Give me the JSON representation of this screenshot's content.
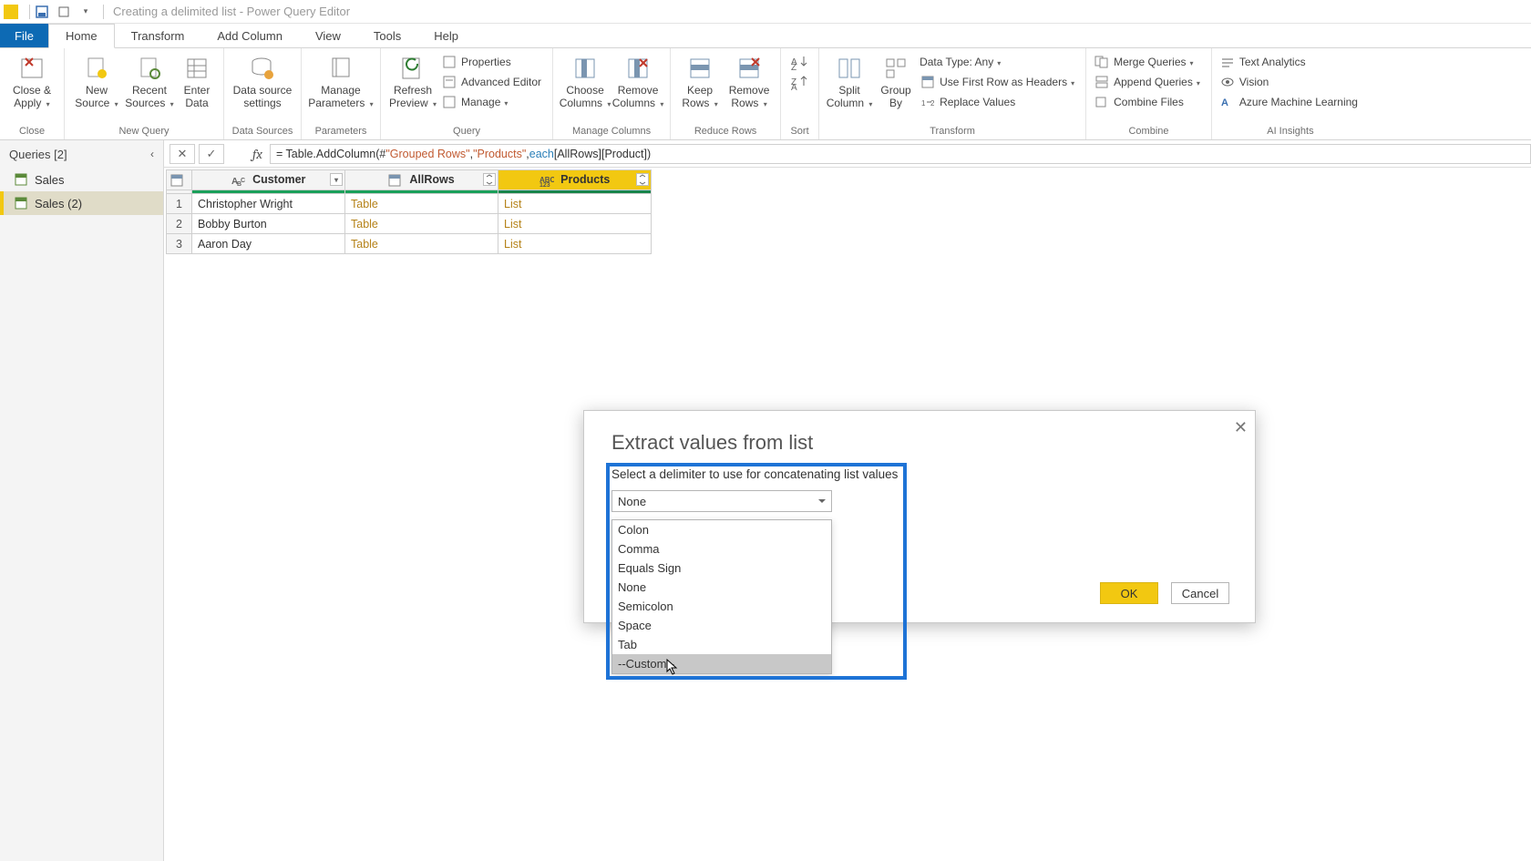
{
  "window": {
    "title": "Creating a delimited list - Power Query Editor"
  },
  "tabs": {
    "file": "File",
    "home": "Home",
    "transform": "Transform",
    "addcolumn": "Add Column",
    "view": "View",
    "tools": "Tools",
    "help": "Help"
  },
  "ribbon": {
    "close": {
      "label": "Close &\nApply",
      "group": "Close"
    },
    "newquery": {
      "newsource": "New\nSource",
      "recent": "Recent\nSources",
      "enter": "Enter\nData",
      "group": "New Query"
    },
    "datasources": {
      "settings": "Data source\nsettings",
      "group": "Data Sources"
    },
    "parameters": {
      "manage": "Manage\nParameters",
      "group": "Parameters"
    },
    "query": {
      "refresh": "Refresh\nPreview",
      "properties": "Properties",
      "advanced": "Advanced Editor",
      "manage": "Manage",
      "group": "Query"
    },
    "managecols": {
      "choose": "Choose\nColumns",
      "remove": "Remove\nColumns",
      "group": "Manage Columns"
    },
    "reducerows": {
      "keep": "Keep\nRows",
      "remove": "Remove\nRows",
      "group": "Reduce Rows"
    },
    "sort": {
      "group": "Sort"
    },
    "transform": {
      "split": "Split\nColumn",
      "group_by": "Group\nBy",
      "datatype": "Data Type: Any",
      "firstrow": "Use First Row as Headers",
      "replace": "Replace Values",
      "group": "Transform"
    },
    "combine": {
      "merge": "Merge Queries",
      "append": "Append Queries",
      "combine": "Combine Files",
      "group": "Combine"
    },
    "ai": {
      "text": "Text Analytics",
      "vision": "Vision",
      "azml": "Azure Machine Learning",
      "group": "AI Insights"
    }
  },
  "queries": {
    "header": "Queries [2]",
    "items": [
      "Sales",
      "Sales (2)"
    ]
  },
  "formula": {
    "prefix": "= Table.AddColumn(#",
    "s1": "\"Grouped Rows\"",
    "s2": "\"Products\"",
    "kw": "each",
    "tail": " [AllRows][Product])"
  },
  "grid": {
    "headers": {
      "customer": "Customer",
      "allrows": "AllRows",
      "products": "Products"
    },
    "rows": [
      {
        "n": "1",
        "customer": "Christopher Wright",
        "allrows": "Table",
        "products": "List"
      },
      {
        "n": "2",
        "customer": "Bobby Burton",
        "allrows": "Table",
        "products": "List"
      },
      {
        "n": "3",
        "customer": "Aaron Day",
        "allrows": "Table",
        "products": "List"
      }
    ]
  },
  "dialog": {
    "title": "Extract values from list",
    "prompt": "Select a delimiter to use for concatenating list values",
    "selected": "None",
    "options": [
      "Colon",
      "Comma",
      "Equals Sign",
      "None",
      "Semicolon",
      "Space",
      "Tab",
      "--Custom--"
    ],
    "ok": "OK",
    "cancel": "Cancel"
  }
}
